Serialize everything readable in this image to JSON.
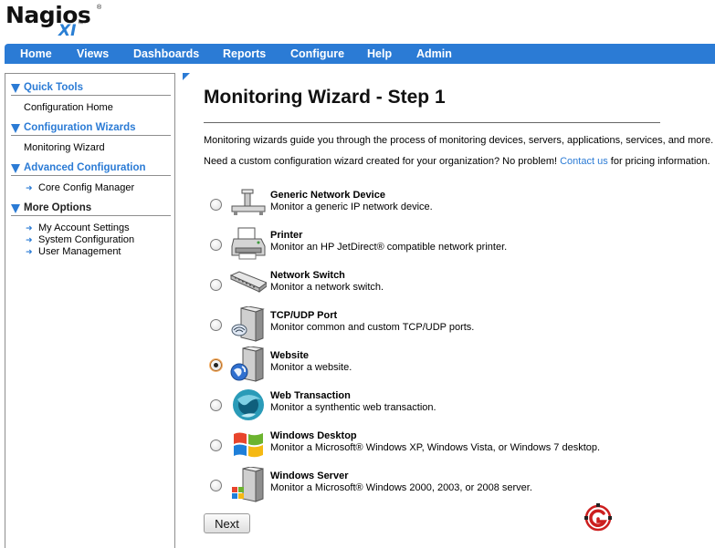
{
  "logo": {
    "brand": "Nagios",
    "registered": "®",
    "product": "XI",
    "trademark": "™"
  },
  "topnav": [
    "Home",
    "Views",
    "Dashboards",
    "Reports",
    "Configure",
    "Help",
    "Admin"
  ],
  "sidebar": {
    "sections": [
      {
        "title": "Quick Tools",
        "items": [
          "Configuration Home"
        ]
      },
      {
        "title": "Configuration Wizards",
        "items": [
          "Monitoring Wizard"
        ]
      },
      {
        "title": "Advanced Configuration",
        "items": [
          "Core Config Manager"
        ]
      },
      {
        "title": "More Options",
        "items": [
          "My Account Settings",
          "System Configuration",
          "User Management"
        ]
      }
    ]
  },
  "main": {
    "title": "Monitoring Wizard - Step 1",
    "intro": "Monitoring wizards guide you through the process of monitoring devices, servers, applications, services, and more. Sele",
    "custom_prefix": "Need a custom configuration wizard created for your organization? No problem!",
    "custom_link": "Contact us",
    "custom_suffix": "for pricing information.",
    "wizards": [
      {
        "name": "Generic Network Device",
        "desc": "Monitor a generic IP network device.",
        "icon": "network-device-icon",
        "selected": false
      },
      {
        "name": "Printer",
        "desc": "Monitor an HP JetDirect® compatible network printer.",
        "icon": "printer-icon",
        "selected": false
      },
      {
        "name": "Network Switch",
        "desc": "Monitor a network switch.",
        "icon": "switch-icon",
        "selected": false
      },
      {
        "name": "TCP/UDP Port",
        "desc": "Monitor common and custom TCP/UDP ports.",
        "icon": "port-icon",
        "selected": false
      },
      {
        "name": "Website",
        "desc": "Monitor a website.",
        "icon": "website-icon",
        "selected": true
      },
      {
        "name": "Web Transaction",
        "desc": "Monitor a synthentic web transaction.",
        "icon": "web-transaction-icon",
        "selected": false
      },
      {
        "name": "Windows Desktop",
        "desc": "Monitor a Microsoft® Windows XP, Windows Vista, or Windows 7 desktop.",
        "icon": "windows-desktop-icon",
        "selected": false
      },
      {
        "name": "Windows Server",
        "desc": "Monitor a Microsoft® Windows 2000, 2003, or 2008 server.",
        "icon": "windows-server-icon",
        "selected": false
      }
    ],
    "next_label": "Next"
  },
  "colors": {
    "accent": "#2b7bd5",
    "nav_text": "#ffffff",
    "selected_ring": "#f3b36e"
  }
}
